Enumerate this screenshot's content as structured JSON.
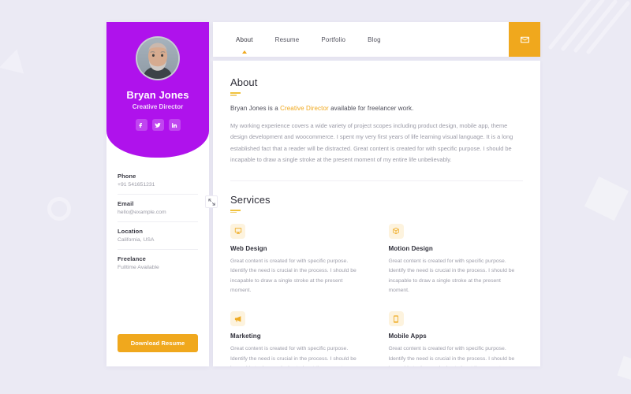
{
  "theme": {
    "page_bg": "#ebeaf4",
    "purple": "#af12ec",
    "accent_orange": "#f0a81d",
    "accent_yellow": "#f0c23d",
    "panel_white": "#ffffff"
  },
  "profile": {
    "name": "Bryan Jones",
    "role": "Creative Director",
    "socials": [
      {
        "name": "facebook",
        "label": "Facebook"
      },
      {
        "name": "twitter",
        "label": "Twitter"
      },
      {
        "name": "linkedin",
        "label": "LinkedIn"
      }
    ]
  },
  "contact": {
    "items": [
      {
        "label": "Phone",
        "value": "+91 541651231"
      },
      {
        "label": "Email",
        "value": "hello@example.com"
      },
      {
        "label": "Location",
        "value": "California, USA"
      },
      {
        "label": "Freelance",
        "value": "Fulltime Available"
      }
    ]
  },
  "sidebar": {
    "download_label": "Download Resume"
  },
  "nav": {
    "items": [
      {
        "label": "About",
        "active": true
      },
      {
        "label": "Resume",
        "active": false
      },
      {
        "label": "Portfolio",
        "active": false
      },
      {
        "label": "Blog",
        "active": false
      }
    ],
    "mail_icon": "envelope-icon"
  },
  "about": {
    "title": "About",
    "lead_before": "Bryan Jones is a ",
    "lead_highlight": "Creative Director",
    "lead_after": " available for freelancer work.",
    "body": "My working experience covers a wide variety of project scopes including product design, mobile app, theme design development and woocommerce. I spent my very first years of life learning visual language. It is a long established fact that a reader will be distracted. Great content is created for with specific purpose. I should be incapable to draw a single stroke at the present moment of my entire life unbelievably."
  },
  "services": {
    "title": "Services",
    "items": [
      {
        "icon": "monitor-icon",
        "name": "Web Design",
        "desc": "Great content is created for with specific purpose. Identify the need is crucial in the process. I should be incapable to draw a single stroke at the present moment."
      },
      {
        "icon": "cube-icon",
        "name": "Motion Design",
        "desc": "Great content is created for with specific purpose. Identify the need is crucial in the process. I should be incapable to draw a single stroke at the present moment."
      },
      {
        "icon": "megaphone-icon",
        "name": "Marketing",
        "desc": "Great content is created for with specific purpose. Identify the need is crucial in the process. I should be incapable to draw a single stroke at the present moment."
      },
      {
        "icon": "mobile-icon",
        "name": "Mobile Apps",
        "desc": "Great content is created for with specific purpose. Identify the need is crucial in the process. I should be incapable to draw a single stroke at the present moment."
      }
    ]
  },
  "cursor": {
    "icon": "resize-cursor-icon"
  }
}
